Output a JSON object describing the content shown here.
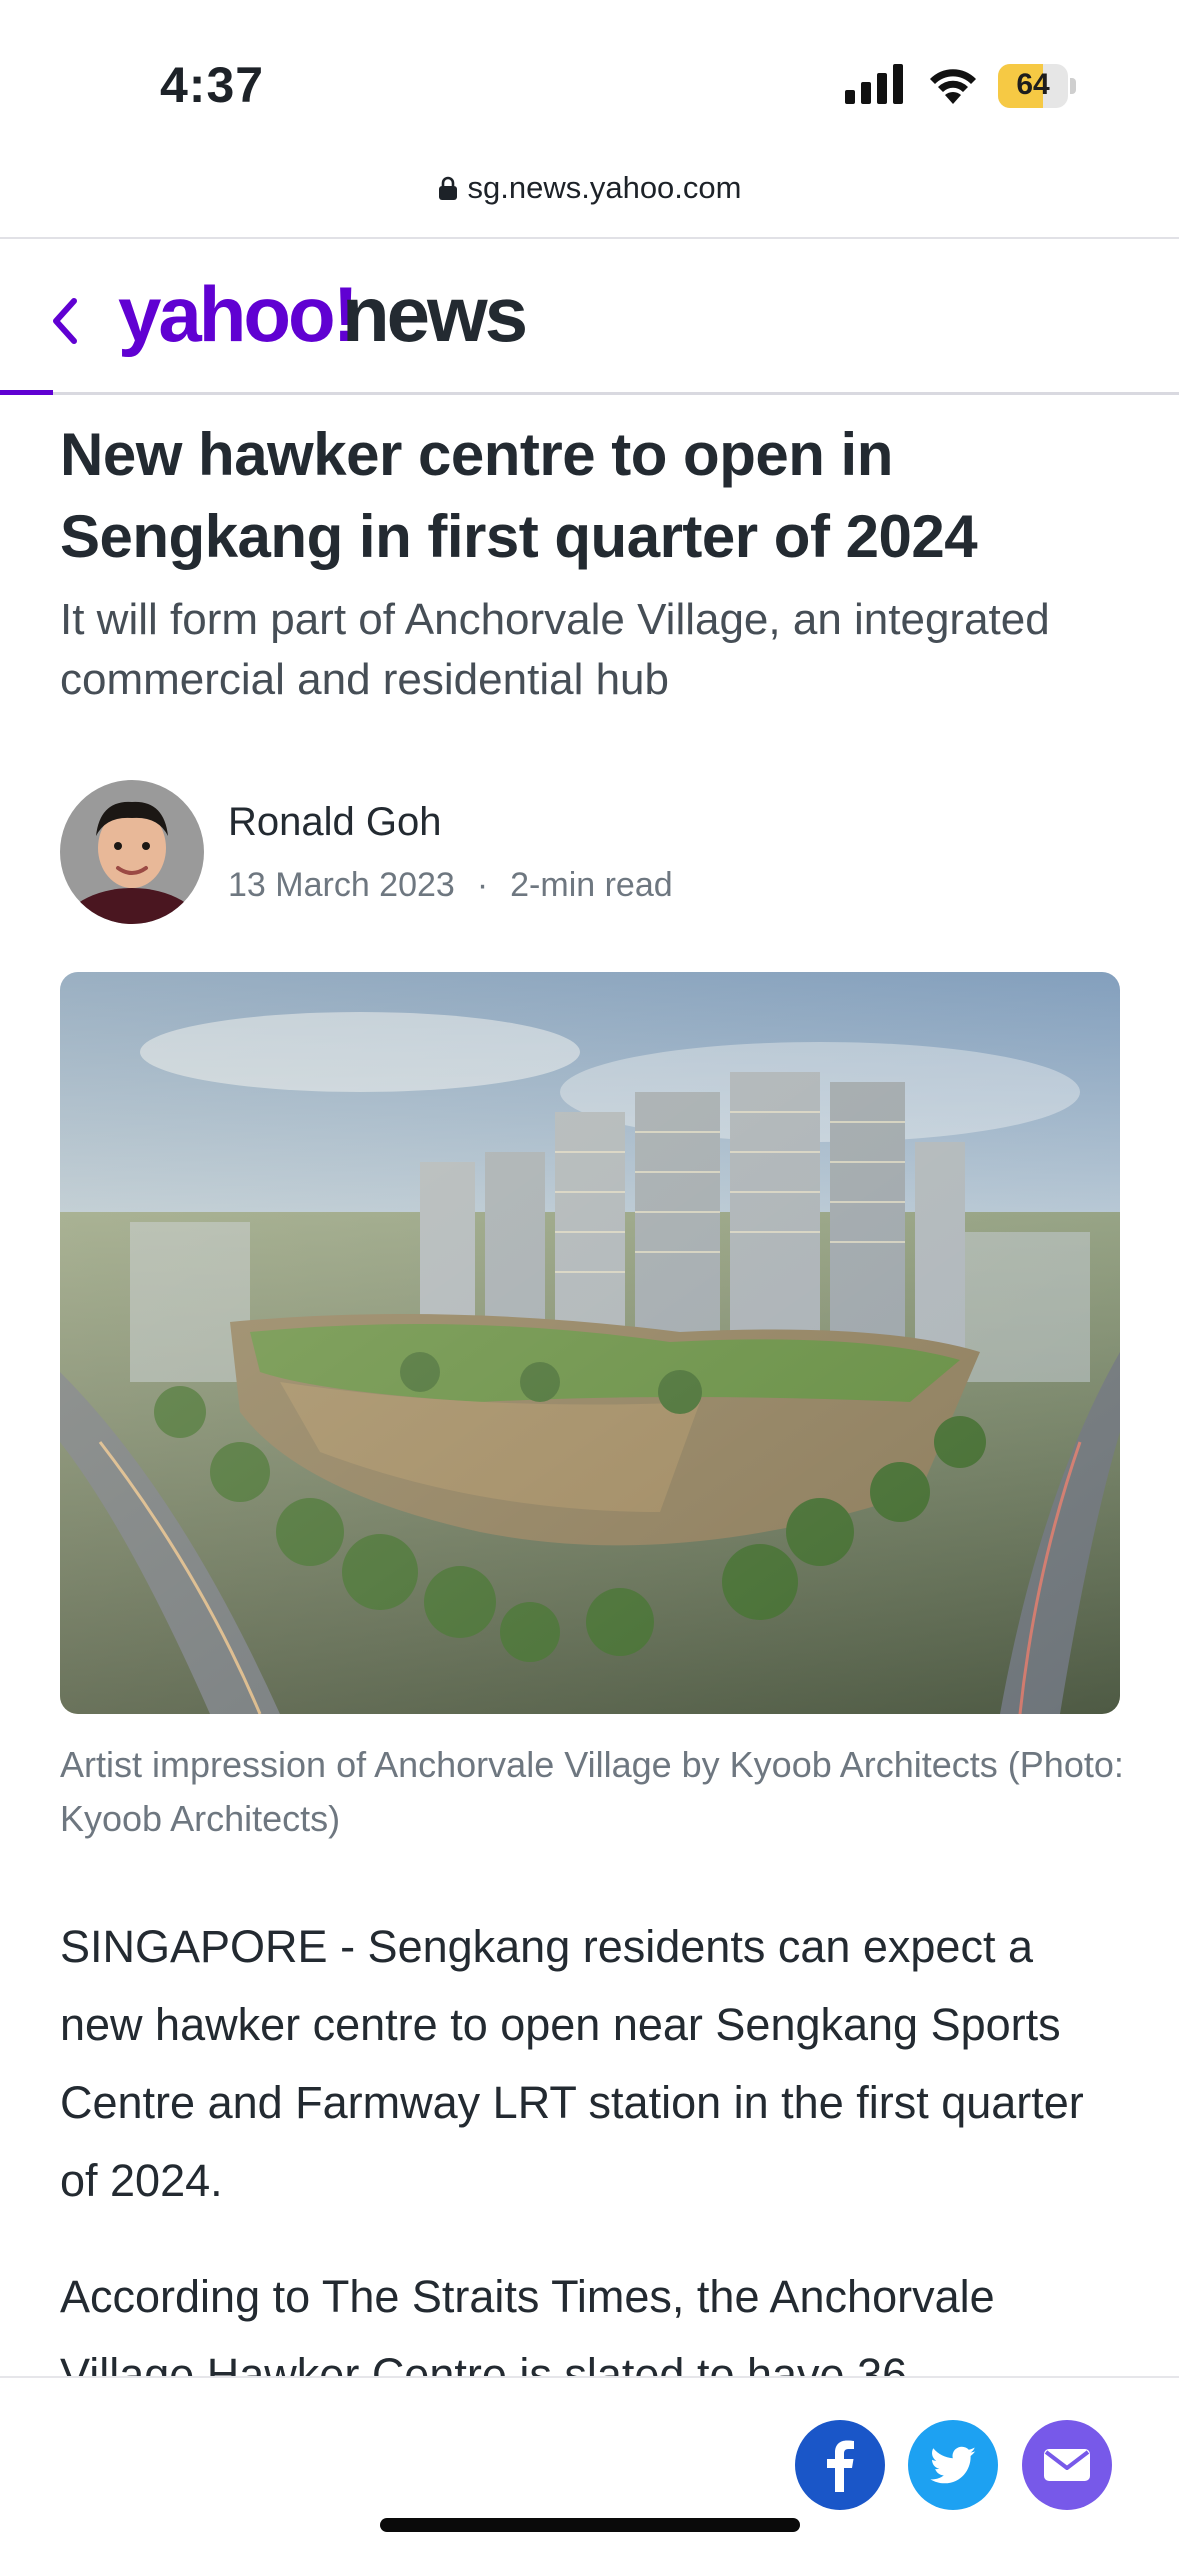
{
  "status_bar": {
    "time": "4:37",
    "battery_level": "64",
    "battery_fraction": 0.64
  },
  "browser": {
    "url": "sg.news.yahoo.com"
  },
  "header": {
    "brand": "yahoo!news"
  },
  "article": {
    "headline": "New hawker centre to open in Sengkang in first quarter of 2024",
    "subheadline": "It will form part of Anchorvale Village, an integrated commercial and residential hub",
    "author": "Ronald Goh",
    "date": "13 March 2023",
    "separator": "·",
    "read_time": "2-min read",
    "image_caption": "Artist impression of Anchorvale Village by Kyoob Architects (Photo: Kyoob Architects)",
    "paragraphs": [
      "SINGAPORE - Sengkang residents can expect a new hawker centre to open near Sengkang Sports Centre and Farmway LRT station in the first quarter of 2024.",
      "According to The Straits Times, the Anchorvale Village Hawker Centre is slated to have 36"
    ]
  },
  "share": {
    "icons": [
      "facebook-icon",
      "twitter-icon",
      "mail-icon"
    ]
  },
  "colors": {
    "brand_purple": "#6001d2",
    "facebook": "#1a56c8",
    "twitter": "#1da1f2",
    "mail": "#7759e9",
    "battery": "#f6c944"
  }
}
